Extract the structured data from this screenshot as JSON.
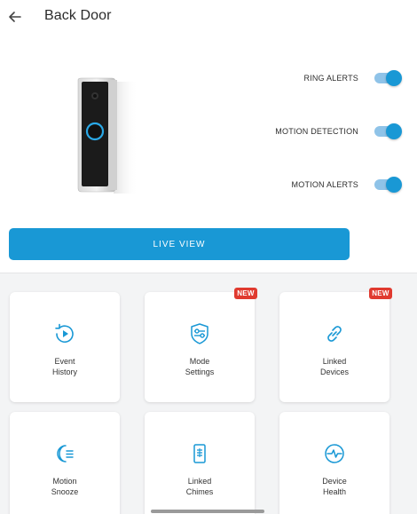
{
  "header": {
    "title": "Back Door",
    "back_icon": "arrow-left-icon"
  },
  "settings": {
    "ring_alerts": {
      "label": "RING ALERTS",
      "on": true
    },
    "motion_detection": {
      "label": "MOTION DETECTION",
      "on": true
    },
    "motion_alerts": {
      "label": "MOTION ALERTS",
      "on": true
    }
  },
  "live_view": {
    "label": "LIVE VIEW"
  },
  "tiles": {
    "event_history": {
      "line1": "Event",
      "line2": "History",
      "icon": "play-history-icon"
    },
    "mode_settings": {
      "line1": "Mode",
      "line2": "Settings",
      "icon": "shield-sliders-icon",
      "badge": "NEW"
    },
    "linked_devices": {
      "line1": "Linked",
      "line2": "Devices",
      "icon": "link-icon",
      "badge": "NEW"
    },
    "motion_snooze": {
      "line1": "Motion",
      "line2": "Snooze",
      "icon": "moon-snooze-icon"
    },
    "linked_chimes": {
      "line1": "Linked",
      "line2": "Chimes",
      "icon": "chime-icon"
    },
    "device_health": {
      "line1": "Device",
      "line2": "Health",
      "icon": "heart-pulse-icon"
    }
  },
  "colors": {
    "accent": "#1998d5",
    "badge": "#e03a2f",
    "background_grid": "#f3f4f5"
  }
}
